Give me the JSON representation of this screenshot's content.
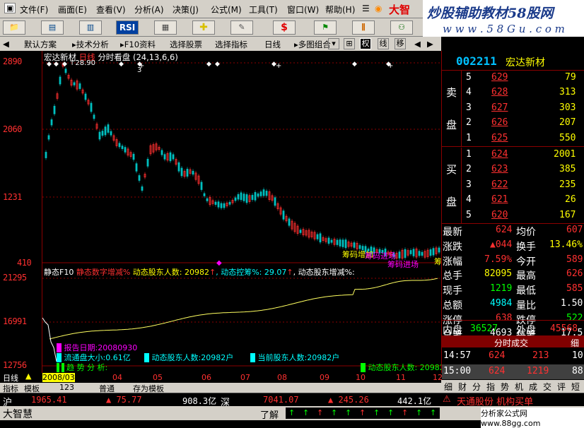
{
  "menu": {
    "items": [
      "文件(F)",
      "画面(E)",
      "查看(V)",
      "分析(A)",
      "决策(J)",
      "公式(M)",
      "工具(T)",
      "窗口(W)",
      "帮助(H)"
    ],
    "app_name": "大智"
  },
  "banner": {
    "title": "炒股辅助教材58股网",
    "url": "w w w . 5 8 G u . c o m"
  },
  "toolbar": {
    "rsi_label": "RSI",
    "dollar_label": "$"
  },
  "nav": {
    "items": [
      "默认方案",
      "技术分析",
      "F10资料",
      "选择股票",
      "选择指标",
      "日线",
      "多图组合"
    ],
    "toggles": [
      "权",
      "线",
      "移"
    ]
  },
  "chart": {
    "header": {
      "name": "宏达新材",
      "period": "日线",
      "mode": "分时看盘",
      "params": "(24,13,6,6)"
    },
    "price_axis": [
      "2890",
      "2060",
      "1231",
      "410"
    ],
    "peak_label": "28.90",
    "marker_labels": [
      {
        "text": "筹码增加",
        "color": "#ffff00"
      },
      {
        "text": "筹码进场",
        "color": "#ff00ff"
      },
      {
        "text": "筹码进场",
        "color": "#ff00ff"
      },
      {
        "text": "筹",
        "color": "#ffff00"
      }
    ],
    "lower_axis": [
      "21295",
      "16991",
      "12756"
    ],
    "lower_header": {
      "name": "静态F10",
      "items": [
        {
          "text": "静态数字增减%",
          "color": "#ff3030"
        },
        {
          "text": "动态股东人数: 20982",
          "color": "#ffff00"
        },
        {
          "text": "动态控筹%: 29.07",
          "color": "#00ffff"
        },
        {
          "text": "动态股东增减%:",
          "color": "#ffffff"
        }
      ]
    },
    "lower_labels": [
      {
        "text": "报告日期:20080930",
        "color": "#ff00ff"
      },
      {
        "text": "流通盘大小:0.61亿",
        "color": "#00ffff"
      },
      {
        "text": "动态股东人数:20982户",
        "color": "#00ffff"
      },
      {
        "text": "当前股东人数:20982户",
        "color": "#00ffff"
      },
      {
        "text": "趋 势 分 析:",
        "color": "#00ff00"
      },
      {
        "text": "动态股东人数: 20982",
        "color": "#00ff00"
      }
    ],
    "date_axis": [
      "2008/03",
      "04",
      "05",
      "06",
      "07",
      "08",
      "09",
      "10",
      "11",
      "12"
    ]
  },
  "bottom": {
    "period": "日线",
    "tabs": [
      "指标",
      "模板",
      "123",
      "普通",
      "存为模板"
    ]
  },
  "quote": {
    "code": "002211",
    "name": "宏达新材",
    "sell_label": [
      "卖",
      "盘"
    ],
    "buy_label": [
      "买",
      "盘"
    ],
    "sell": [
      {
        "level": "5",
        "price": "629",
        "vol": "79"
      },
      {
        "level": "4",
        "price": "628",
        "vol": "313"
      },
      {
        "level": "3",
        "price": "627",
        "vol": "303"
      },
      {
        "level": "2",
        "price": "626",
        "vol": "207"
      },
      {
        "level": "1",
        "price": "625",
        "vol": "550"
      }
    ],
    "buy": [
      {
        "level": "1",
        "price": "624",
        "vol": "2001"
      },
      {
        "level": "2",
        "price": "623",
        "vol": "385"
      },
      {
        "level": "3",
        "price": "622",
        "vol": "235"
      },
      {
        "level": "4",
        "price": "621",
        "vol": "26"
      },
      {
        "level": "5",
        "price": "620",
        "vol": "167"
      }
    ],
    "stats": [
      {
        "l1": "最新",
        "v1": "624",
        "c1": "#ff3030",
        "l2": "均价",
        "v2": "607",
        "c2": "#ff3030"
      },
      {
        "l1": "涨跌",
        "v1": "▲044",
        "c1": "#ff3030",
        "l2": "换手",
        "v2": "13.46%",
        "c2": "#ffff00"
      },
      {
        "l1": "涨幅",
        "v1": "7.59%",
        "c1": "#ff3030",
        "l2": "今开",
        "v2": "589",
        "c2": "#ff3030"
      },
      {
        "l1": "总手",
        "v1": "82095",
        "c1": "#ffff00",
        "l2": "最高",
        "v2": "626",
        "c2": "#ff3030"
      },
      {
        "l1": "现手",
        "v1": "1219",
        "c1": "#00ff00",
        "l2": "最低",
        "v2": "585",
        "c2": "#ff3030"
      },
      {
        "l1": "总额",
        "v1": "4984",
        "c1": "#00ffff",
        "l2": "量比",
        "v2": "1.50",
        "c2": "#ffffff"
      },
      {
        "l1": "涨停",
        "v1": "638",
        "c1": "#ff3030",
        "l2": "跌停",
        "v2": "522",
        "c2": "#00ff00"
      },
      {
        "l1": "总笔",
        "v1": "4693",
        "c1": "#ffffff",
        "l2": "每笔",
        "v2": "17.5",
        "c2": "#ffffff"
      }
    ],
    "inner_label": "内盘",
    "inner": "36527",
    "outer_label": "外盘",
    "outer": "45568",
    "trade_title": "分时成交",
    "trade_tag": "细",
    "trades": [
      {
        "time": "14:57",
        "price": "624",
        "vol": "213",
        "n": "10"
      },
      {
        "time": "15:00",
        "price": "624",
        "vol": "1219",
        "n": "88"
      }
    ],
    "bottom_tabs": [
      "细",
      "财",
      "分",
      "指",
      "势",
      "机",
      "成",
      "交",
      "评",
      "短"
    ]
  },
  "status": {
    "index1_name": "沪",
    "index1_value": "1965.41",
    "index1_change": "▲ 75.77",
    "index1_amount": "908.3亿",
    "index2_name": "深",
    "index2_value": "7041.07",
    "index2_change": "▲ 245.26",
    "index2_amount": "442.1亿",
    "app_name": "大智慧",
    "ticker": "了解",
    "news": "天通股份 机构买单",
    "watermark": "分析家公式网 www.88gg.com"
  },
  "colors": {
    "up": "#ff3030",
    "down": "#00ffff",
    "axis": "#8b0000",
    "bg": "#000000"
  }
}
